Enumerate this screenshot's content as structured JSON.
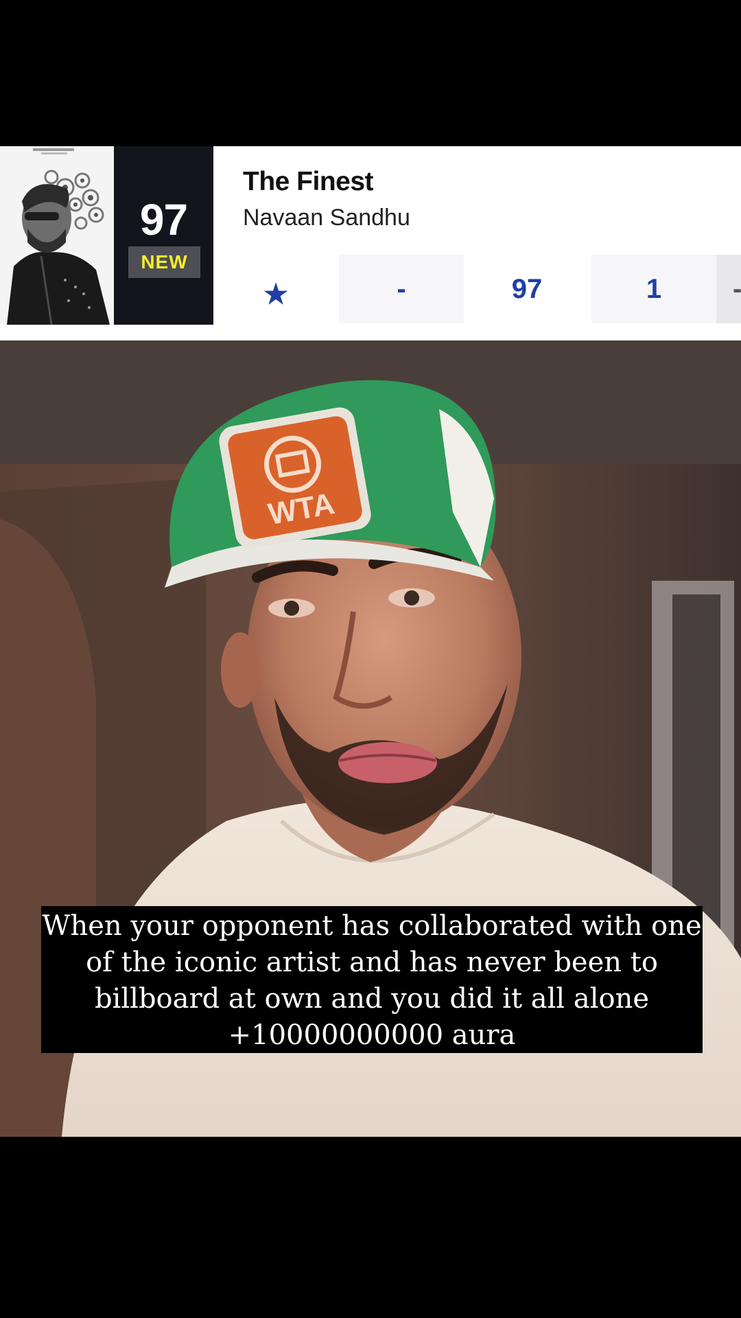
{
  "chart_entry": {
    "rank": "97",
    "status_badge": "NEW",
    "title": "The Finest",
    "artist": "Navaan Sandhu",
    "stats": {
      "award_icon": "star-icon",
      "last_week": "-",
      "peak": "97",
      "weeks_on_chart": "1",
      "overflow": "-"
    }
  },
  "caption": {
    "lines": [
      "When your opponent has collaborated with one",
      "of the iconic artist and has never been to",
      "billboard at own and you did it all alone",
      "+10000000000 aura"
    ]
  },
  "cap_logo": "WTA",
  "colors": {
    "rank_box": "#14141d",
    "badge_text": "#f4ee2a",
    "stat_text": "#1f3fa6",
    "cap_green": "#2f9a5a",
    "cap_patch": "#d9622a"
  }
}
